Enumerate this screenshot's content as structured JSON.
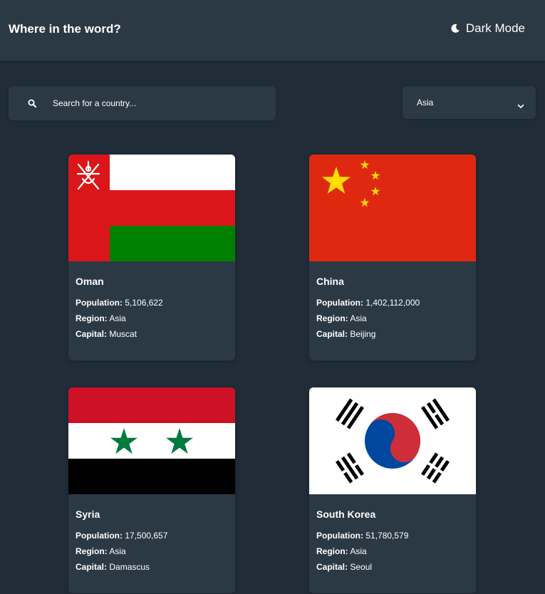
{
  "header": {
    "title": "Where in the word?",
    "theme_toggle_label": "Dark Mode",
    "theme_icon": "moon-icon"
  },
  "search": {
    "placeholder": "Search for a country...",
    "value": "",
    "icon": "search-icon"
  },
  "filter": {
    "selected": "Asia",
    "icon": "chevron-down-icon"
  },
  "labels": {
    "population": "Population:",
    "region": "Region:",
    "capital": "Capital:"
  },
  "countries": [
    {
      "name": "Oman",
      "population": "5,106,622",
      "region": "Asia",
      "capital": "Muscat"
    },
    {
      "name": "China",
      "population": "1,402,112,000",
      "region": "Asia",
      "capital": "Beijing"
    },
    {
      "name": "Syria",
      "population": "17,500,657",
      "region": "Asia",
      "capital": "Damascus"
    },
    {
      "name": "South Korea",
      "population": "51,780,579",
      "region": "Asia",
      "capital": "Seoul"
    }
  ],
  "colors": {
    "background": "#202c37",
    "elements": "#2b3945",
    "text": "#ffffff"
  }
}
